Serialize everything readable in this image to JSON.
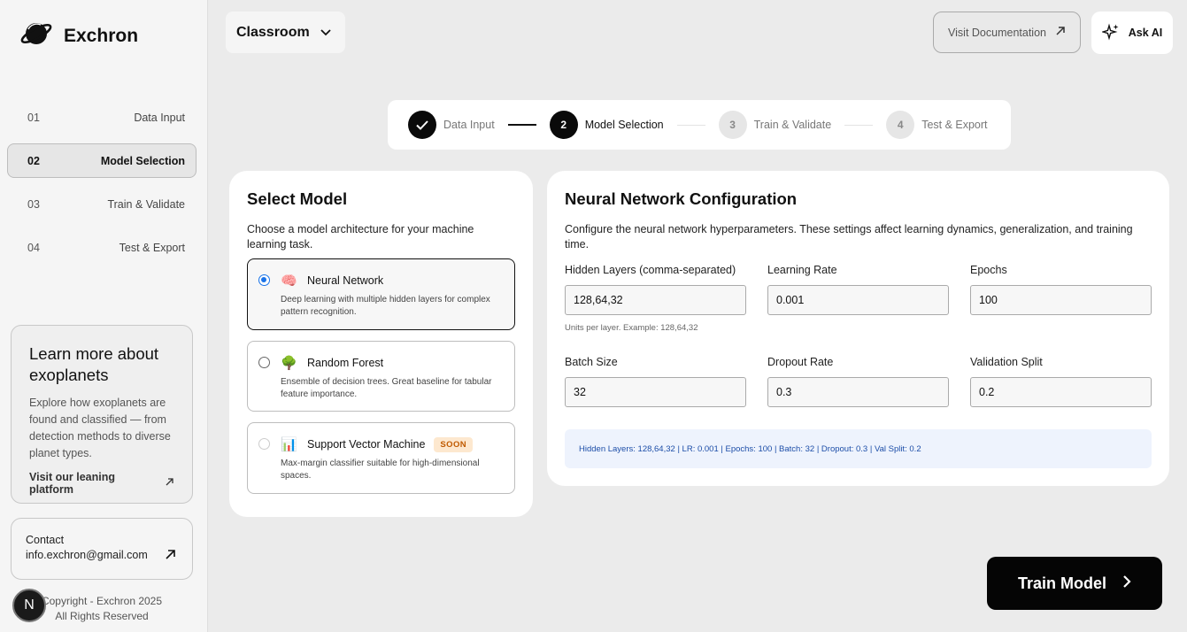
{
  "brand": {
    "name": "Exchron"
  },
  "sidebar": {
    "items": [
      {
        "num": "01",
        "label": "Data Input",
        "active": false
      },
      {
        "num": "02",
        "label": "Model Selection",
        "active": true
      },
      {
        "num": "03",
        "label": "Train & Validate",
        "active": false
      },
      {
        "num": "04",
        "label": "Test & Export",
        "active": false
      }
    ],
    "learn": {
      "title": "Learn more about exoplanets",
      "text": "Explore how exoplanets are found and classified — from detection methods to diverse planet types.",
      "link": "Visit our leaning platform"
    },
    "contact": {
      "label": "Contact",
      "email": "info.exchron@gmail.com"
    },
    "copyright_line1": "Copyright - Exchron 2025",
    "copyright_line2": "All Rights Reserved",
    "badge": "N"
  },
  "header": {
    "dropdown_value": "Classroom",
    "doc_button": "Visit Documentation",
    "ai_button": "Ask AI"
  },
  "stepper": [
    {
      "num": "✓",
      "label": "Data Input",
      "state": "done"
    },
    {
      "num": "2",
      "label": "Model Selection",
      "state": "current"
    },
    {
      "num": "3",
      "label": "Train & Validate",
      "state": "upcoming"
    },
    {
      "num": "4",
      "label": "Test & Export",
      "state": "upcoming"
    }
  ],
  "select_model": {
    "title": "Select Model",
    "description": "Choose a model architecture for your machine learning task.",
    "options": [
      {
        "icon": "🧠",
        "icon_name": "brain-icon",
        "name": "Neural Network",
        "desc": "Deep learning with multiple hidden layers for complex pattern recognition.",
        "selected": true
      },
      {
        "icon": "🌳",
        "icon_name": "tree-icon",
        "name": "Random Forest",
        "desc": "Ensemble of decision trees. Great baseline for tabular feature importance.",
        "selected": false
      },
      {
        "icon": "📊",
        "icon_name": "chart-icon",
        "name": "Support Vector Machine",
        "badge": "SOON",
        "desc": "Max-margin classifier suitable for high-dimensional spaces.",
        "selected": false,
        "disabled": true
      }
    ]
  },
  "config": {
    "title": "Neural Network Configuration",
    "description": "Configure the neural network hyperparameters. These settings affect learning dynamics, generalization, and training time.",
    "fields": {
      "hidden_layers": {
        "label": "Hidden Layers (comma-separated)",
        "value": "128,64,32",
        "hint": "Units per layer. Example: 128,64,32"
      },
      "learning_rate": {
        "label": "Learning Rate",
        "value": "0.001"
      },
      "epochs": {
        "label": "Epochs",
        "value": "100"
      },
      "batch_size": {
        "label": "Batch Size",
        "value": "32"
      },
      "dropout_rate": {
        "label": "Dropout Rate",
        "value": "0.3"
      },
      "validation_split": {
        "label": "Validation Split",
        "value": "0.2"
      }
    },
    "summary": "Hidden Layers: 128,64,32 | LR: 0.001 | Epochs: 100 | Batch: 32 | Dropout: 0.3 | Val Split: 0.2"
  },
  "train_button": "Train Model",
  "colors": {
    "accent_blue": "#1a73e8",
    "soon_badge_bg": "#fde8cf",
    "summary_bg": "#eef3fd"
  }
}
